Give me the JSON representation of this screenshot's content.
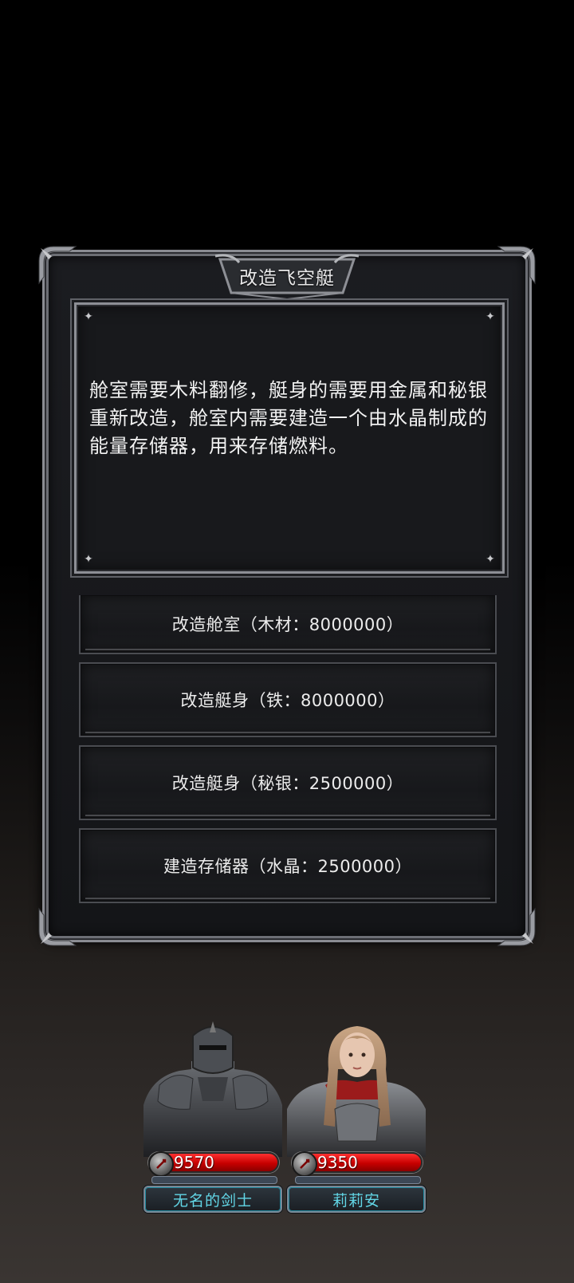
{
  "dialog": {
    "title": "改造飞空艇",
    "description": "舱室需要木料翻修，艇身的需要用金属和秘银重新改造，舱室内需要建造一个由水晶制成的能量存储器，用来存储燃料。",
    "options": [
      {
        "label": "改造舱室（木材：8000000）"
      },
      {
        "label": "改造艇身（铁：8000000）"
      },
      {
        "label": "改造艇身（秘银：2500000）"
      },
      {
        "label": "建造存储器（水晶：2500000）"
      }
    ]
  },
  "party": [
    {
      "name": "无名的剑士",
      "hp": "9570",
      "hp_fill": 1.0,
      "portrait_icon": "armored-knight-portrait",
      "hp_icon": "sword-emblem-icon"
    },
    {
      "name": "莉莉安",
      "hp": "9350",
      "hp_fill": 1.0,
      "portrait_icon": "female-knight-portrait",
      "hp_icon": "sword-emblem-icon"
    }
  ],
  "colors": {
    "hp_red": "#d00000",
    "name_cyan": "#62d6e6",
    "frame_silver": "#8d8f95"
  }
}
